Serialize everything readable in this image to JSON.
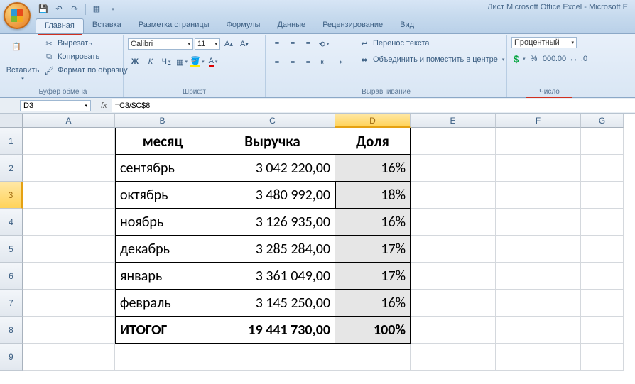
{
  "app": {
    "title": "Лист Microsoft Office Excel - Microsoft E"
  },
  "tabs": {
    "home": "Главная",
    "insert": "Вставка",
    "layout": "Разметка страницы",
    "formulas": "Формулы",
    "data": "Данные",
    "review": "Рецензирование",
    "view": "Вид"
  },
  "ribbon": {
    "clipboard": {
      "paste": "Вставить",
      "cut": "Вырезать",
      "copy": "Копировать",
      "formatpainter": "Формат по образцу",
      "label": "Буфер обмена"
    },
    "font": {
      "name": "Calibri",
      "size": "11",
      "label": "Шрифт",
      "bold": "Ж",
      "italic": "К",
      "underline": "Ч"
    },
    "align": {
      "wrap": "Перенос текста",
      "merge": "Объединить и поместить в центре",
      "label": "Выравнивание"
    },
    "number": {
      "format": "Процентный",
      "label": "Число"
    }
  },
  "namebox": "D3",
  "formula": "=C3/$C$8",
  "columns": [
    "A",
    "B",
    "C",
    "D",
    "E",
    "F",
    "G"
  ],
  "rows": [
    "1",
    "2",
    "3",
    "4",
    "5",
    "6",
    "7",
    "8",
    "9"
  ],
  "table": {
    "headers": {
      "month": "месяц",
      "revenue": "Выручка",
      "share": "Доля"
    },
    "data": [
      {
        "month": "сентябрь",
        "revenue": "3 042 220,00",
        "share": "16%"
      },
      {
        "month": "октябрь",
        "revenue": "3 480 992,00",
        "share": "18%"
      },
      {
        "month": "ноябрь",
        "revenue": "3 126 935,00",
        "share": "16%"
      },
      {
        "month": "декабрь",
        "revenue": "3 285 284,00",
        "share": "17%"
      },
      {
        "month": "январь",
        "revenue": "3 361 049,00",
        "share": "17%"
      },
      {
        "month": "февраль",
        "revenue": "3 145 250,00",
        "share": "16%"
      }
    ],
    "total": {
      "label": "ИТОГОГ",
      "revenue": "19 441 730,00",
      "share": "100%"
    }
  },
  "active_cell": "D3"
}
